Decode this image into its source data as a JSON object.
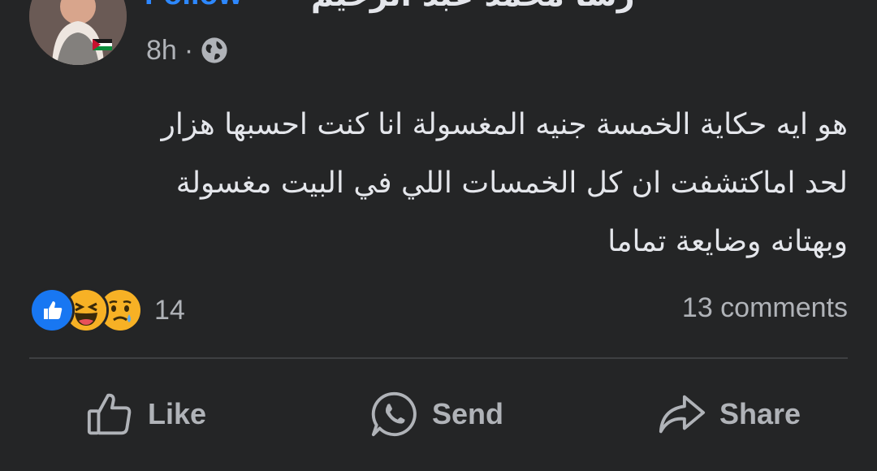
{
  "post": {
    "follow_label": "Follow",
    "separator": "·",
    "author_name": "رشا محمد عبد الرحيم",
    "time": "8h",
    "meta_separator": "·",
    "audience_icon": "globe-icon",
    "text_lines": [
      "هو ايه حكاية الخمسة جنيه المغسولة انا كنت احسبها هزار",
      "لحد اماكتشفت ان كل الخمسات اللي في البيت مغسولة",
      "وبهتانه وضايعة تماما"
    ]
  },
  "reactions": {
    "icons": [
      "like-reaction-icon",
      "haha-reaction-icon",
      "sad-reaction-icon"
    ],
    "count": "14"
  },
  "comments_label": "13 comments",
  "actions": {
    "like_label": "Like",
    "send_label": "Send",
    "share_label": "Share"
  },
  "colors": {
    "background": "#242526",
    "text": "#e4e6eb",
    "secondary_text": "#b0b3b8",
    "accent": "#2d88ff",
    "divider": "#3e4042"
  }
}
